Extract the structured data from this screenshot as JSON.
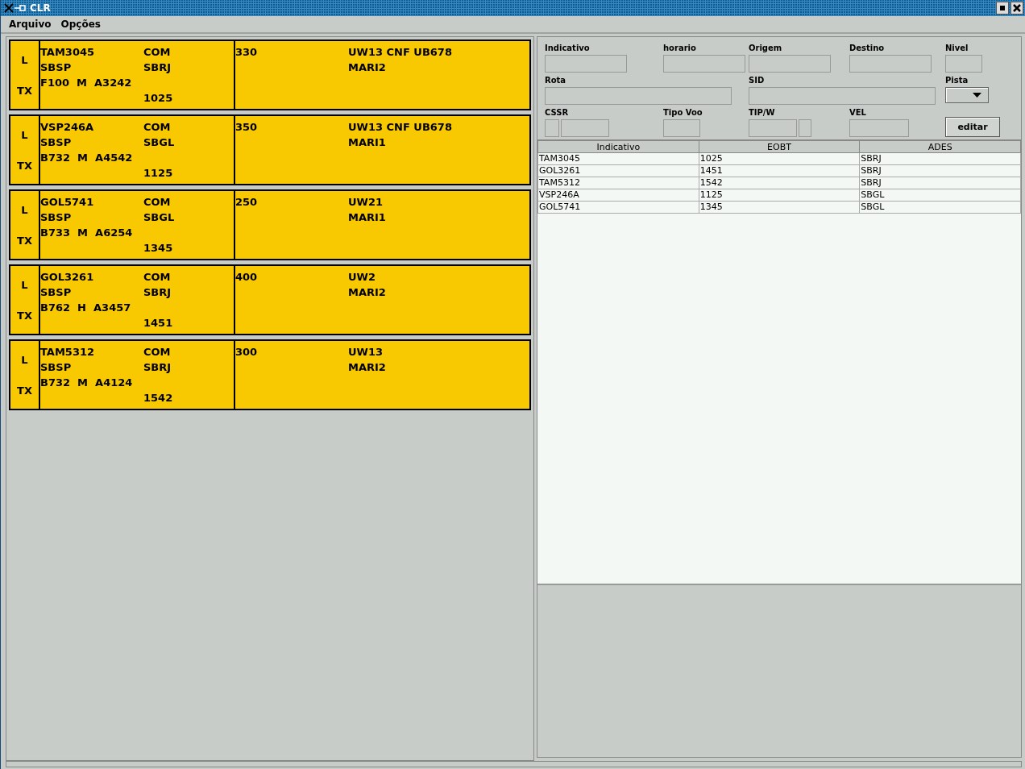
{
  "window": {
    "title": "CLR"
  },
  "menu": [
    {
      "label": "Arquivo"
    },
    {
      "label": "Opções"
    }
  ],
  "strips": [
    {
      "mark_top": "L",
      "mark_bottom": "TX",
      "callsign": "TAM3045",
      "flight_type": "COM",
      "origin": "SBSP",
      "destination": "SBRJ",
      "aircraft": "F100  M  A3242",
      "time": "1025",
      "level": "330",
      "route": "UW13 CNF UB678",
      "sid": "MARI2"
    },
    {
      "mark_top": "L",
      "mark_bottom": "TX",
      "callsign": "VSP246A",
      "flight_type": "COM",
      "origin": "SBSP",
      "destination": "SBGL",
      "aircraft": "B732  M  A4542",
      "time": "1125",
      "level": "350",
      "route": "UW13 CNF UB678",
      "sid": "MARI1"
    },
    {
      "mark_top": "L",
      "mark_bottom": "TX",
      "callsign": "GOL5741",
      "flight_type": "COM",
      "origin": "SBSP",
      "destination": "SBGL",
      "aircraft": "B733  M  A6254",
      "time": "1345",
      "level": "250",
      "route": "UW21",
      "sid": "MARI1"
    },
    {
      "mark_top": "L",
      "mark_bottom": "TX",
      "callsign": "GOL3261",
      "flight_type": "COM",
      "origin": "SBSP",
      "destination": "SBRJ",
      "aircraft": "B762  H  A3457",
      "time": "1451",
      "level": "400",
      "route": "UW2",
      "sid": "MARI2"
    },
    {
      "mark_top": "L",
      "mark_bottom": "TX",
      "callsign": "TAM5312",
      "flight_type": "COM",
      "origin": "SBSP",
      "destination": "SBRJ",
      "aircraft": "B732  M  A4124",
      "time": "1542",
      "level": "300",
      "route": "UW13",
      "sid": "MARI2"
    }
  ],
  "form": {
    "fields": [
      {
        "kind": "text",
        "label": "Indicativo"
      },
      {
        "kind": "text",
        "label": "horario"
      },
      {
        "kind": "text",
        "label": "Origem"
      },
      {
        "kind": "text",
        "label": "Destino"
      },
      {
        "kind": "small",
        "label": "Nivel"
      },
      {
        "kind": "wide",
        "label": "Rota"
      },
      {
        "kind": "wide",
        "label": "SID"
      },
      {
        "kind": "combo",
        "label": "Pista"
      },
      {
        "kind": "split",
        "label": "CSSR"
      },
      {
        "kind": "small",
        "label": "Tipo Voo"
      },
      {
        "kind": "splitr",
        "label": "TIP/W"
      },
      {
        "kind": "text",
        "label": "VEL"
      },
      {
        "kind": "button",
        "label": "editar"
      }
    ]
  },
  "table": {
    "columns": [
      "Indicativo",
      "EOBT",
      "ADES"
    ],
    "rows": [
      [
        "TAM3045",
        "1025",
        "SBRJ"
      ],
      [
        "GOL3261",
        "1451",
        "SBRJ"
      ],
      [
        "TAM5312",
        "1542",
        "SBRJ"
      ],
      [
        "VSP246A",
        "1125",
        "SBGL"
      ],
      [
        "GOL5741",
        "1345",
        "SBGL"
      ]
    ]
  }
}
